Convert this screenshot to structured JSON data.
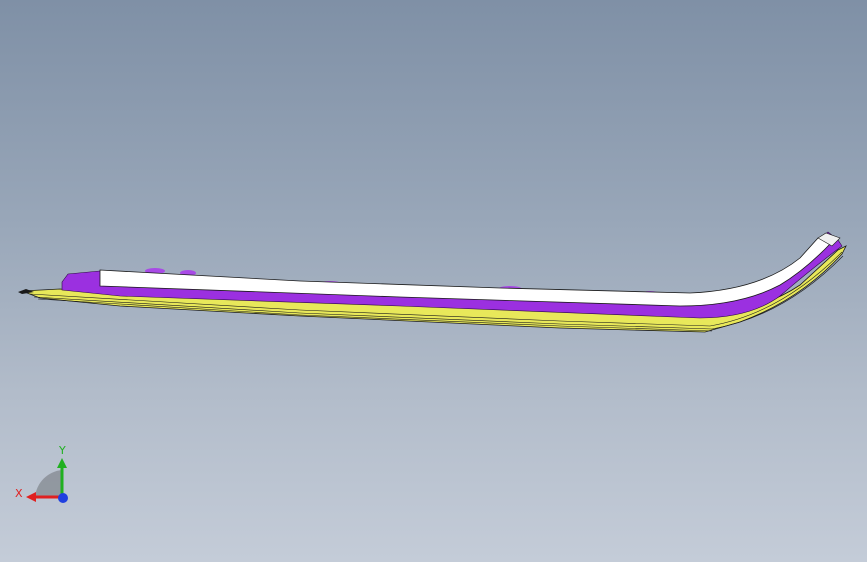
{
  "viewport": {
    "background_top": "#7f90a6",
    "background_bottom": "#c4ccd8"
  },
  "model": {
    "part_colors": {
      "top_plate": "#ffffff",
      "upper_layer": "#9b30e0",
      "laminate": "#e8e85a",
      "edge": "#1a1a1a"
    }
  },
  "triad": {
    "x_label": "X",
    "y_label": "Y",
    "x_color": "#e02020",
    "y_color": "#20b020",
    "z_color": "#2040e0"
  }
}
